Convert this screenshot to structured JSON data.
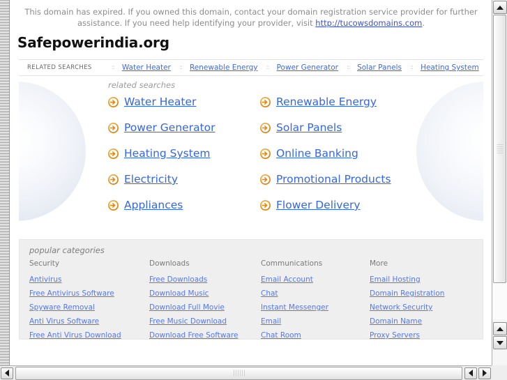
{
  "notice": {
    "text_before": "This domain has expired. If you owned this domain, contact your domain registration service provider for further assistance. If you need help identifying your provider, visit ",
    "link_text": "http://tucowsdomains.com",
    "text_after": "."
  },
  "domain": {
    "title": "Safepowerindia.org"
  },
  "related_bar": {
    "label": "RELATED SEARCHES",
    "separator": "::",
    "links": [
      "Water Heater",
      "Renewable Energy",
      "Power Generator",
      "Solar Panels",
      "Heating System"
    ]
  },
  "hero": {
    "label": "related searches",
    "icon": "arrow-circle-right-icon",
    "links": [
      "Water Heater",
      "Renewable Energy",
      "Power Generator",
      "Solar Panels",
      "Heating System",
      "Online Banking",
      "Electricity",
      "Promotional Products",
      "Appliances",
      "Flower Delivery"
    ]
  },
  "categories": {
    "title": "popular categories",
    "columns": [
      {
        "heading": "Security",
        "links": [
          "Antivirus",
          "Free Antivirus Software",
          "Spyware Removal",
          "Anti Virus Software",
          "Free Anti Virus Download"
        ]
      },
      {
        "heading": "Downloads",
        "links": [
          "Free Downloads",
          "Download Music",
          "Download Full Movie",
          "Free Music Download",
          "Download Free Software"
        ]
      },
      {
        "heading": "Communications",
        "links": [
          "Email Account",
          "Chat",
          "Instant Messenger",
          "Email",
          "Chat Room"
        ]
      },
      {
        "heading": "More",
        "links": [
          "Email Hosting",
          "Domain Registration",
          "Network Security",
          "Domain Name",
          "Proxy Servers"
        ]
      }
    ]
  },
  "colors": {
    "link_blue": "#3366ee",
    "bar_link_blue": "#4169e1",
    "notice_gray": "#8c8c8c",
    "arrow_orange": "#e8820c",
    "categories_bg": "#efefef"
  },
  "scrollbars": {
    "v_up_icon": "triangle-up-icon",
    "v_down_icon": "triangle-down-icon",
    "h_left_icon": "triangle-left-icon",
    "h_right_icon": "triangle-right-icon"
  }
}
